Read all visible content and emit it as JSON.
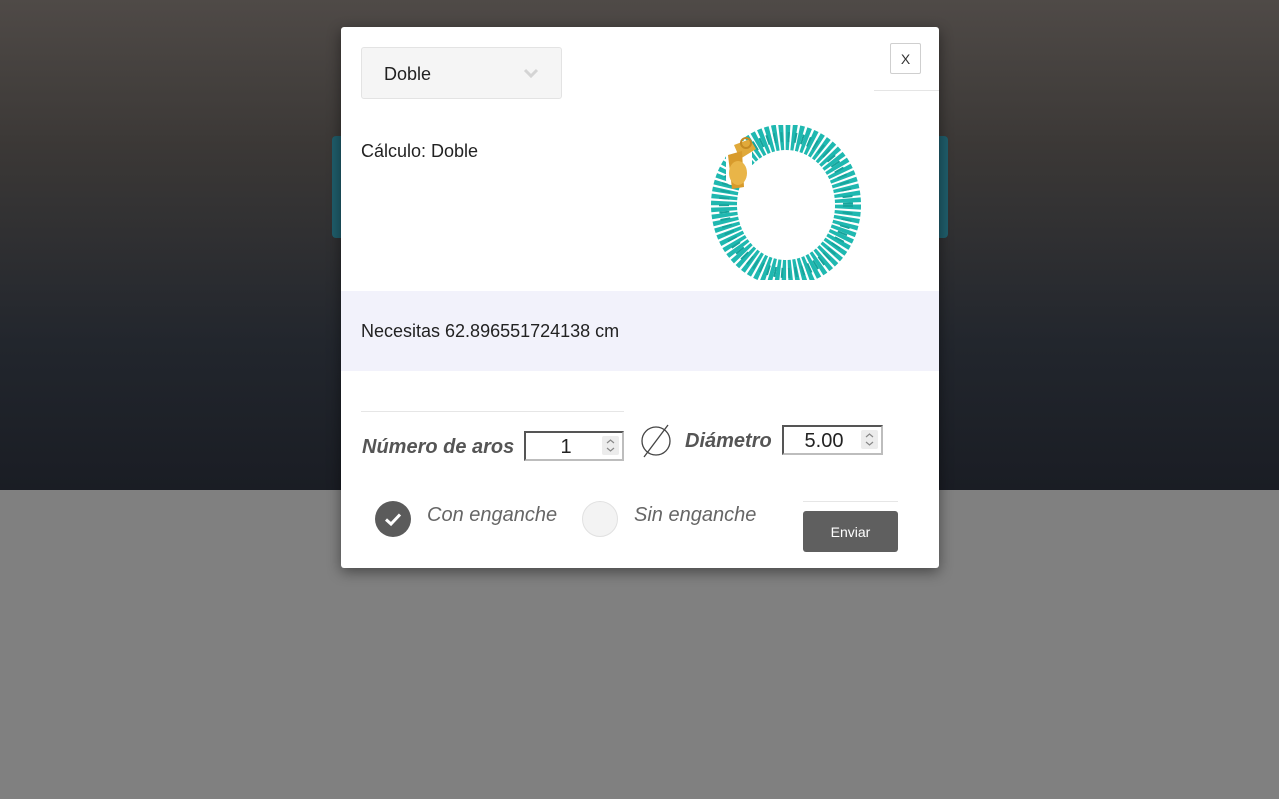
{
  "modal": {
    "type_select": {
      "value": "Doble"
    },
    "close_label": "X",
    "calc_label": "Cálculo: Doble",
    "product_image": "turquoise-beaded-bracelet",
    "result_text": "Necesitas 62.896551724138 cm",
    "aros": {
      "label": "Número de aros",
      "value": "1"
    },
    "diametro": {
      "label": "Diámetro",
      "value": "5.00"
    },
    "radios": [
      {
        "label": "Con enganche",
        "checked": true
      },
      {
        "label": "Sin enganche",
        "checked": false
      }
    ],
    "submit_label": "Enviar"
  },
  "colors": {
    "accent_dark": "#5f5f5f",
    "result_band": "#f2f2fb",
    "product": "#1fb8b0"
  }
}
